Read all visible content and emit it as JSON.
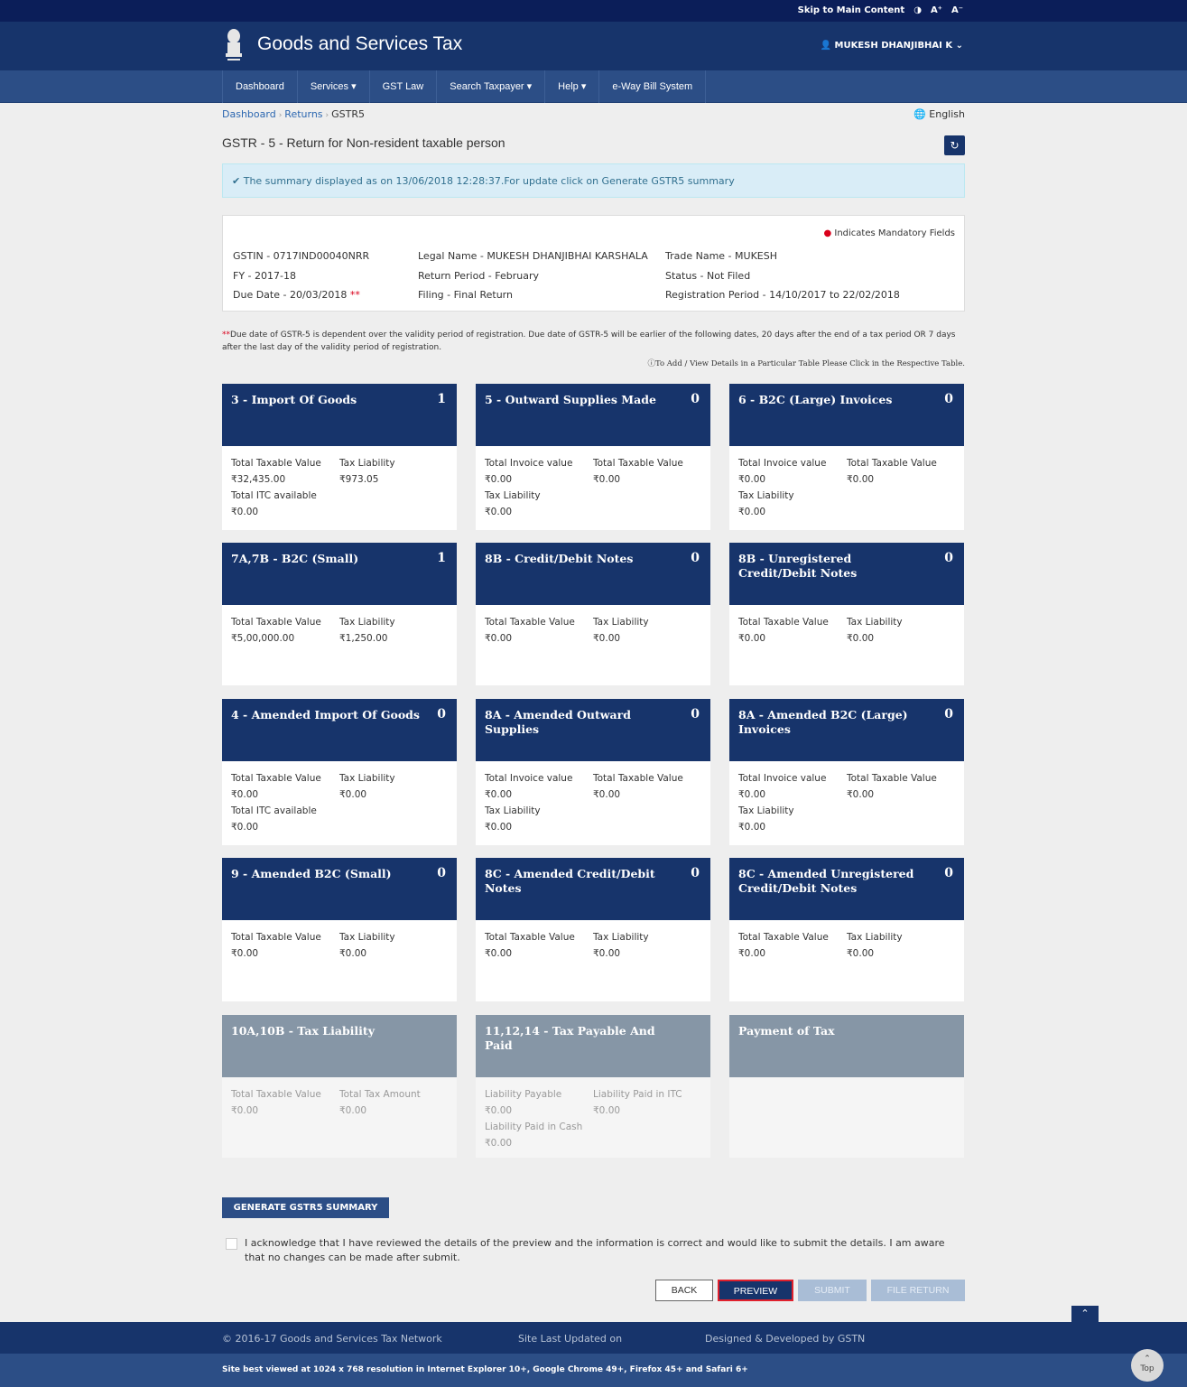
{
  "topbar": {
    "skip": "Skip to Main Content",
    "contrast_icon": "contrast-icon",
    "font_increase": "A⁺",
    "font_decrease": "A⁻"
  },
  "header": {
    "title": "Goods and Services Tax",
    "user": "MUKESH DHANJIBHAI K"
  },
  "nav": [
    "Dashboard",
    "Services ▾",
    "GST Law",
    "Search Taxpayer ▾",
    "Help ▾",
    "e-Way Bill System"
  ],
  "breadcrumb": [
    "Dashboard",
    "Returns",
    "GSTR5"
  ],
  "language": "English",
  "page_title": "GSTR - 5 - Return for Non-resident taxable person",
  "alert": "The summary displayed as on 13/06/2018 12:28:37.For update click on Generate GSTR5 summary",
  "info": {
    "mandatory": "Indicates Mandatory Fields",
    "col1": [
      "GSTIN - 0717IND00040NRR",
      "FY - 2017-18",
      "Due Date - 20/03/2018"
    ],
    "col2": [
      "Legal Name - MUKESH DHANJIBHAI KARSHALA",
      "Return Period - February",
      "Filing - Final Return"
    ],
    "col3": [
      "Trade Name - MUKESH",
      "Status - Not Filed",
      "Registration Period - 14/10/2017 to 22/02/2018"
    ]
  },
  "note": "Due date of GSTR-5 is dependent over the validity period of registration. Due date of GSTR-5 will be earlier of the following dates, 20 days after the end of a tax period OR 7 days after the last day of the validity period of registration.",
  "note2": "To Add / View Details in a Particular Table Please Click in the Respective Table.",
  "tiles": [
    {
      "title": "3 - Import Of Goods",
      "count": "1",
      "fields": [
        [
          "Total Taxable Value",
          "₹32,435.00"
        ],
        [
          "Tax Liability",
          "₹973.05"
        ],
        [
          "Total ITC available",
          "₹0.00"
        ]
      ]
    },
    {
      "title": "5 - Outward Supplies Made",
      "count": "0",
      "fields": [
        [
          "Total Invoice value",
          "₹0.00"
        ],
        [
          "Total Taxable Value",
          "₹0.00"
        ],
        [
          "Tax Liability",
          "₹0.00"
        ]
      ]
    },
    {
      "title": "6 - B2C (Large) Invoices",
      "count": "0",
      "fields": [
        [
          "Total Invoice value",
          "₹0.00"
        ],
        [
          "Total Taxable Value",
          "₹0.00"
        ],
        [
          "Tax Liability",
          "₹0.00"
        ]
      ]
    },
    {
      "title": "7A,7B - B2C (Small)",
      "count": "1",
      "fields": [
        [
          "Total Taxable Value",
          "₹5,00,000.00"
        ],
        [
          "Tax Liability",
          "₹1,250.00"
        ]
      ]
    },
    {
      "title": "8B - Credit/Debit Notes",
      "count": "0",
      "fields": [
        [
          "Total Taxable Value",
          "₹0.00"
        ],
        [
          "Tax Liability",
          "₹0.00"
        ]
      ]
    },
    {
      "title": "8B - Unregistered Credit/Debit Notes",
      "count": "0",
      "fields": [
        [
          "Total Taxable Value",
          "₹0.00"
        ],
        [
          "Tax Liability",
          "₹0.00"
        ]
      ]
    },
    {
      "title": "4 - Amended Import Of Goods",
      "count": "0",
      "fields": [
        [
          "Total Taxable Value",
          "₹0.00"
        ],
        [
          "Tax Liability",
          "₹0.00"
        ],
        [
          "Total ITC available",
          "₹0.00"
        ]
      ]
    },
    {
      "title": "8A - Amended Outward Supplies",
      "count": "0",
      "fields": [
        [
          "Total Invoice value",
          "₹0.00"
        ],
        [
          "Total Taxable Value",
          "₹0.00"
        ],
        [
          "Tax Liability",
          "₹0.00"
        ]
      ]
    },
    {
      "title": "8A - Amended B2C (Large) Invoices",
      "count": "0",
      "fields": [
        [
          "Total Invoice value",
          "₹0.00"
        ],
        [
          "Total Taxable Value",
          "₹0.00"
        ],
        [
          "Tax Liability",
          "₹0.00"
        ]
      ]
    },
    {
      "title": "9 - Amended B2C (Small)",
      "count": "0",
      "fields": [
        [
          "Total Taxable Value",
          "₹0.00"
        ],
        [
          "Tax Liability",
          "₹0.00"
        ]
      ]
    },
    {
      "title": "8C - Amended Credit/Debit Notes",
      "count": "0",
      "fields": [
        [
          "Total Taxable Value",
          "₹0.00"
        ],
        [
          "Tax Liability",
          "₹0.00"
        ]
      ]
    },
    {
      "title": "8C - Amended Unregistered Credit/Debit Notes",
      "count": "0",
      "fields": [
        [
          "Total Taxable Value",
          "₹0.00"
        ],
        [
          "Tax Liability",
          "₹0.00"
        ]
      ]
    },
    {
      "title": "10A,10B - Tax Liability",
      "count": "",
      "disabled": true,
      "fields": [
        [
          "Total Taxable Value",
          "₹0.00"
        ],
        [
          "Total Tax Amount",
          "₹0.00"
        ]
      ]
    },
    {
      "title": "11,12,14 - Tax Payable And Paid",
      "count": "",
      "disabled": true,
      "fields": [
        [
          "Liability Payable",
          "₹0.00"
        ],
        [
          "Liability Paid in ITC",
          "₹0.00"
        ],
        [
          "Liability Paid in Cash",
          "₹0.00"
        ]
      ]
    },
    {
      "title": "Payment of Tax",
      "count": "",
      "disabled": true,
      "fields": []
    }
  ],
  "generate_label": "GENERATE GSTR5 SUMMARY",
  "ack_text": "I acknowledge that I have reviewed the details of the preview and the information is correct and would like to submit the details. I am aware that no changes can be made after submit.",
  "buttons": {
    "back": "BACK",
    "preview": "PREVIEW",
    "submit": "SUBMIT",
    "file": "FILE RETURN"
  },
  "footer": {
    "copyright": "© 2016-17 Goods and Services Tax Network",
    "updated": "Site Last Updated on",
    "designed": "Designed & Developed by GSTN",
    "best_viewed": "Site best viewed at 1024 x 768 resolution in Internet Explorer 10+, Google Chrome 49+, Firefox 45+ and Safari 6+",
    "top": "Top"
  }
}
